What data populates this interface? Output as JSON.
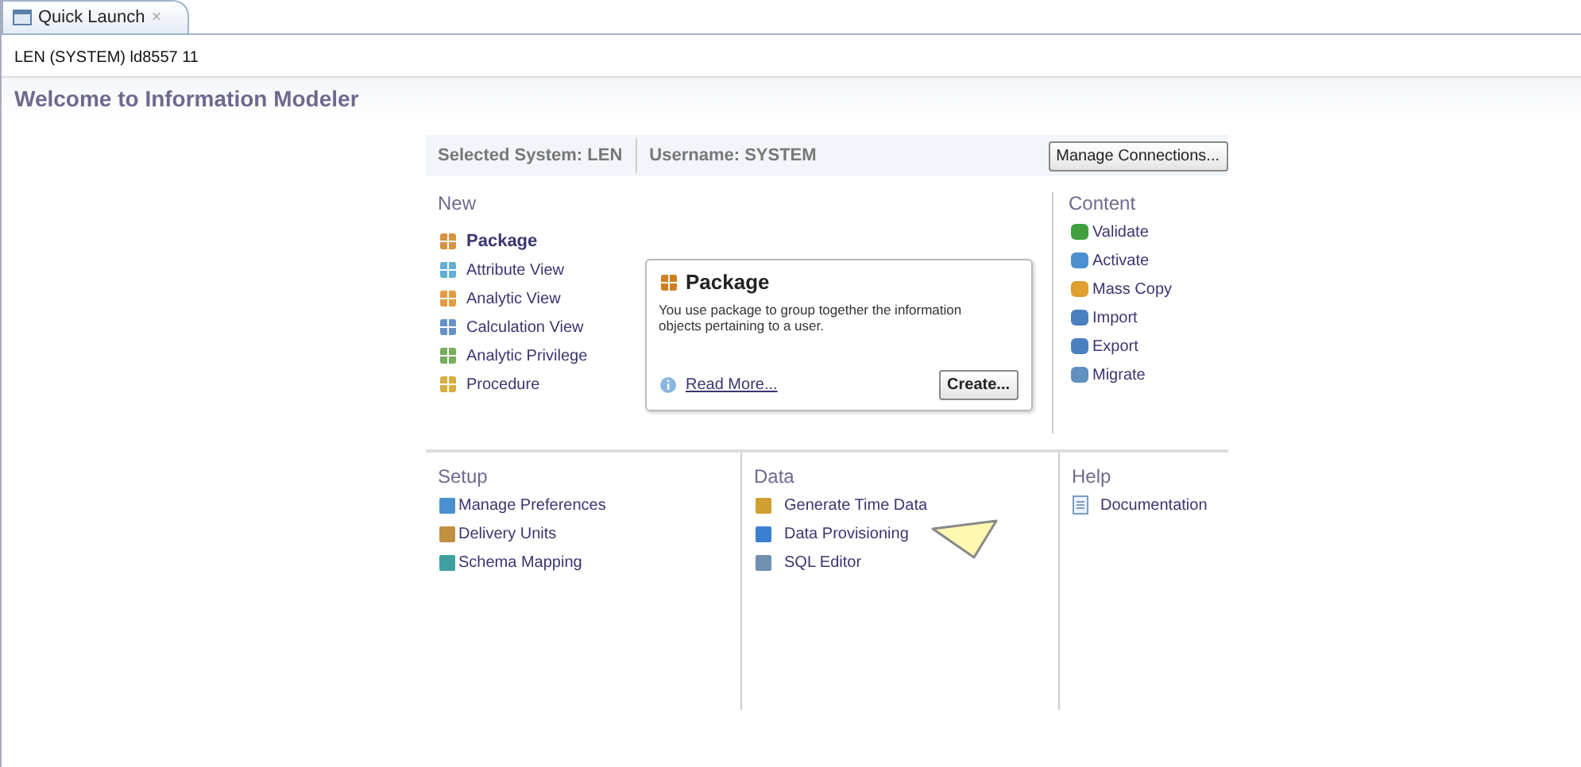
{
  "tab": {
    "label": "Quick Launch",
    "close": "×"
  },
  "system_line": "LEN (SYSTEM)  ld8557 11",
  "title": "Welcome to Information Modeler",
  "header": {
    "system": "Selected System: LEN",
    "username": "Username: SYSTEM",
    "button": "Manage Connections..."
  },
  "new": {
    "heading": "New",
    "items": [
      {
        "label": "Package",
        "selected": true
      },
      {
        "label": "Attribute View",
        "selected": false
      },
      {
        "label": "Analytic View",
        "selected": false
      },
      {
        "label": "Calculation View",
        "selected": false
      },
      {
        "label": "Analytic Privilege",
        "selected": false
      },
      {
        "label": "Procedure",
        "selected": false
      }
    ]
  },
  "detail": {
    "title": "Package",
    "text": "You use package to group together the information objects pertaining to a user.",
    "link": "Read More...",
    "button": "Create..."
  },
  "content": {
    "heading": "Content",
    "items": [
      "Validate",
      "Activate",
      "Mass Copy",
      "Import",
      "Export",
      "Migrate"
    ]
  },
  "setup": {
    "heading": "Setup",
    "items": [
      "Manage Preferences",
      "Delivery Units",
      "Schema Mapping"
    ]
  },
  "data": {
    "heading": "Data",
    "items": [
      "Generate Time Data",
      "Data Provisioning",
      "SQL Editor"
    ]
  },
  "help": {
    "heading": "Help",
    "items": [
      "Documentation"
    ]
  }
}
